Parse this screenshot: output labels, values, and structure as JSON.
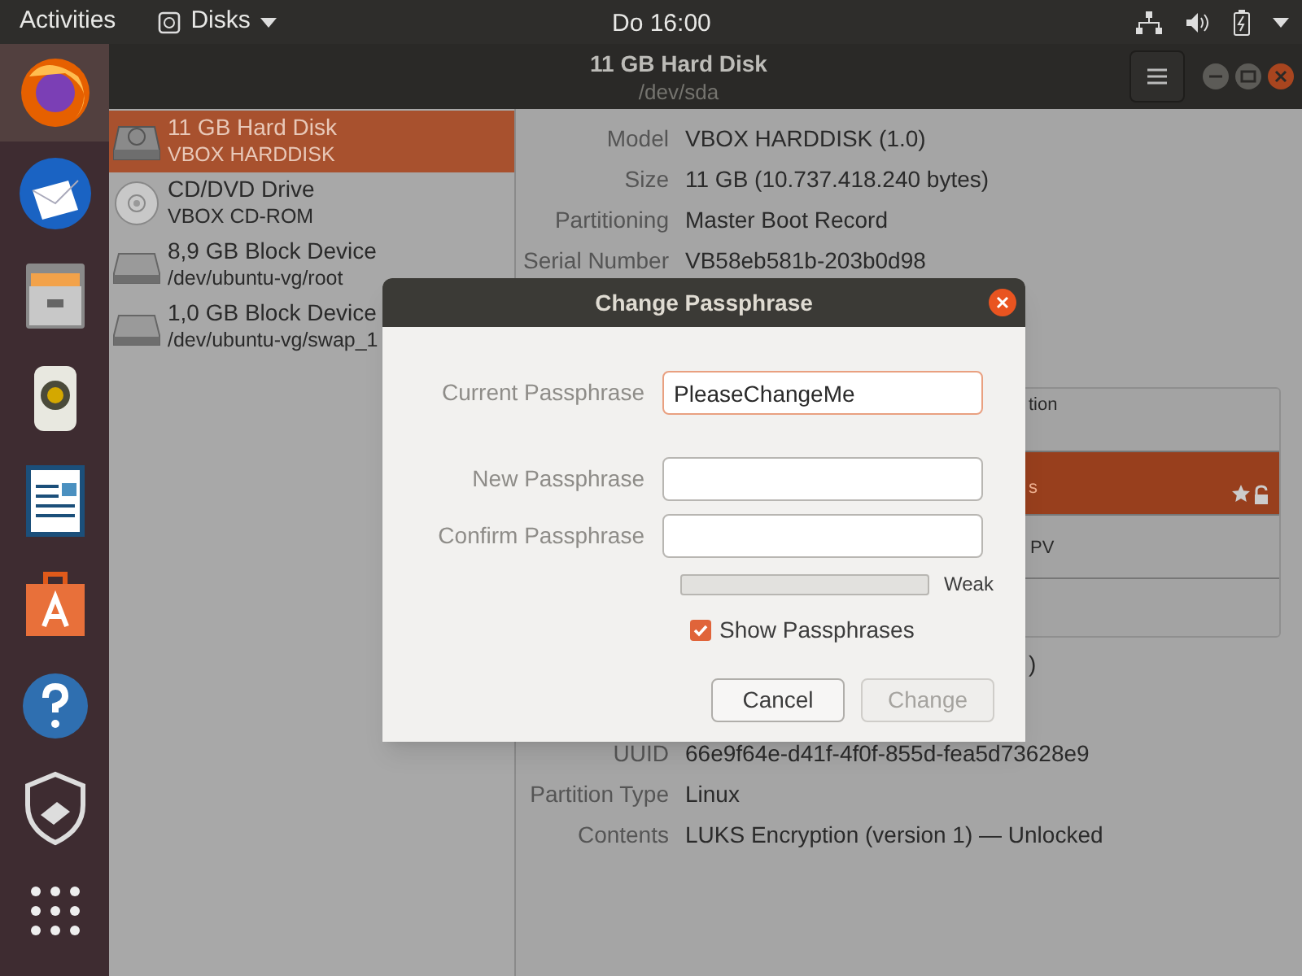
{
  "top_bar": {
    "activities": "Activities",
    "app_menu": "Disks",
    "clock": "Do 16:00"
  },
  "window": {
    "title": "11 GB Hard Disk",
    "subtitle": "/dev/sda"
  },
  "drives": [
    {
      "name": "11 GB Hard Disk",
      "detail": "VBOX HARDDISK",
      "kind": "hdd",
      "selected": true
    },
    {
      "name": "CD/DVD Drive",
      "detail": "VBOX CD-ROM",
      "kind": "cdrom",
      "selected": false
    },
    {
      "name": "8,9 GB Block Device",
      "detail": "/dev/ubuntu-vg/root",
      "kind": "block",
      "selected": false
    },
    {
      "name": "1,0 GB Block Device",
      "detail": "/dev/ubuntu-vg/swap_1",
      "kind": "block",
      "selected": false
    }
  ],
  "details": [
    {
      "label": "Model",
      "value": "VBOX HARDDISK (1.0)"
    },
    {
      "label": "Size",
      "value": "11 GB (10.737.418.240 bytes)"
    },
    {
      "label": "Partitioning",
      "value": "Master Boot Record"
    },
    {
      "label": "Serial Number",
      "value": "VB58eb581b-203b0d98"
    }
  ],
  "volumes": [
    {
      "text": "tion",
      "selected": false
    },
    {
      "text": "s",
      "selected": true
    },
    {
      "text": "PV",
      "selected": false
    }
  ],
  "volume_details": [
    {
      "value": ")"
    },
    {
      "label": "UUID",
      "value": "66e9f64e-d41f-4f0f-855d-fea5d73628e9"
    },
    {
      "label": "Partition Type",
      "value": "Linux"
    },
    {
      "label": "Contents",
      "value": "LUKS Encryption (version 1) — Unlocked"
    }
  ],
  "dialog": {
    "title": "Change Passphrase",
    "fields": [
      {
        "label": "Current Passphrase",
        "value": "PleaseChangeMe",
        "focused": true
      },
      {
        "label": "New Passphrase",
        "focused": false
      },
      {
        "label": "Confirm Passphrase",
        "focused": false
      }
    ],
    "strength": {
      "level": 0,
      "label": "Weak"
    },
    "show_passphrases": {
      "label": "Show Passphrases",
      "checked": true
    },
    "buttons": [
      {
        "label": "Cancel",
        "disabled": false
      },
      {
        "label": "Change",
        "disabled": true
      }
    ]
  }
}
